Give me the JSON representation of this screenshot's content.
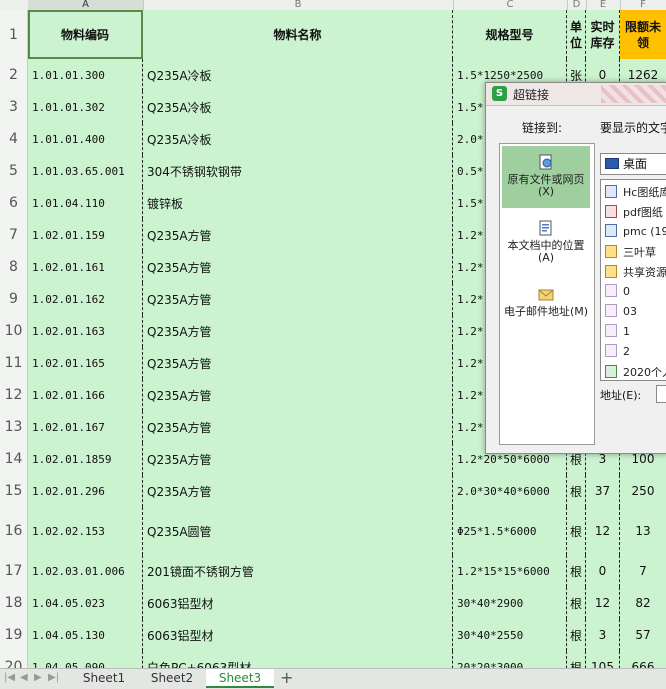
{
  "columns": [
    "A",
    "B",
    "C",
    "D",
    "E",
    "F"
  ],
  "header": {
    "row_number": "1",
    "code": "物料编码",
    "name": "物料名称",
    "spec": "规格型号",
    "unit": "单位",
    "stock": "实时库存",
    "quota": "限额未领"
  },
  "rows": [
    {
      "n": "2",
      "code": "1.01.01.300",
      "name": "Q235A冷板",
      "spec": "1.5*1250*2500",
      "unit": "张",
      "stock": "0",
      "quota": "1262"
    },
    {
      "n": "3",
      "code": "1.01.01.302",
      "name": "Q235A冷板",
      "spec": "1.5*",
      "unit": "",
      "stock": "",
      "quota": ""
    },
    {
      "n": "4",
      "code": "1.01.01.400",
      "name": "Q235A冷板",
      "spec": "2.0*",
      "unit": "",
      "stock": "",
      "quota": ""
    },
    {
      "n": "5",
      "code": "1.01.03.65.001",
      "name": "304不锈钢软钢带",
      "spec": "0.5*",
      "unit": "",
      "stock": "",
      "quota": ""
    },
    {
      "n": "6",
      "code": "1.01.04.110",
      "name": "镀锌板",
      "spec": "1.5*",
      "unit": "",
      "stock": "",
      "quota": ""
    },
    {
      "n": "7",
      "code": "1.02.01.159",
      "name": "Q235A方管",
      "spec": "1.2*",
      "unit": "",
      "stock": "",
      "quota": ""
    },
    {
      "n": "8",
      "code": "1.02.01.161",
      "name": "Q235A方管",
      "spec": "1.2*",
      "unit": "",
      "stock": "",
      "quota": ""
    },
    {
      "n": "9",
      "code": "1.02.01.162",
      "name": "Q235A方管",
      "spec": "1.2*",
      "unit": "",
      "stock": "",
      "quota": ""
    },
    {
      "n": "10",
      "code": "1.02.01.163",
      "name": "Q235A方管",
      "spec": "1.2*",
      "unit": "",
      "stock": "",
      "quota": ""
    },
    {
      "n": "11",
      "code": "1.02.01.165",
      "name": "Q235A方管",
      "spec": "1.2*",
      "unit": "",
      "stock": "",
      "quota": ""
    },
    {
      "n": "12",
      "code": "1.02.01.166",
      "name": "Q235A方管",
      "spec": "1.2*",
      "unit": "",
      "stock": "",
      "quota": ""
    },
    {
      "n": "13",
      "code": "1.02.01.167",
      "name": "Q235A方管",
      "spec": "1.2*",
      "unit": "",
      "stock": "",
      "quota": ""
    },
    {
      "n": "14",
      "code": "1.02.01.1859",
      "name": "Q235A方管",
      "spec": "1.2*20*50*6000",
      "unit": "根",
      "stock": "3",
      "quota": "100"
    },
    {
      "n": "15",
      "code": "1.02.01.296",
      "name": "Q235A方管",
      "spec": "2.0*30*40*6000",
      "unit": "根",
      "stock": "37",
      "quota": "250"
    },
    {
      "n": "16",
      "code": "1.02.02.153",
      "name": "Q235A圆管",
      "spec": "Φ25*1.5*6000",
      "unit": "根",
      "stock": "12",
      "quota": "13"
    },
    {
      "n": "17",
      "code": "1.02.03.01.006",
      "name": "201镜面不锈钢方管",
      "spec": "1.2*15*15*6000",
      "unit": "根",
      "stock": "0",
      "quota": "7"
    },
    {
      "n": "18",
      "code": "1.04.05.023",
      "name": "6063铝型材",
      "spec": "30*40*2900",
      "unit": "根",
      "stock": "12",
      "quota": "82"
    },
    {
      "n": "19",
      "code": "1.04.05.130",
      "name": "6063铝型材",
      "spec": "30*40*2550",
      "unit": "根",
      "stock": "3",
      "quota": "57"
    },
    {
      "n": "20",
      "code": "1.04.05.090",
      "name": "白色PC+6063型材",
      "spec": "20*20*3000",
      "unit": "根",
      "stock": "105",
      "quota": "666"
    }
  ],
  "sheets": [
    "Sheet1",
    "Sheet2",
    "Sheet3"
  ],
  "active_sheet": "Sheet3",
  "add_sheet": "+",
  "dialog": {
    "title": "超链接",
    "logo": "S",
    "link_to": "链接到:",
    "display_text": "要显示的文字",
    "link_types": [
      {
        "label": "原有文件或网页(X)",
        "icon": "web-file-icon"
      },
      {
        "label": "本文档中的位置(A)",
        "icon": "document-place-icon"
      },
      {
        "label": "电子邮件地址(M)",
        "icon": "email-icon"
      }
    ],
    "location": "桌面",
    "files": [
      {
        "name": "Hc图纸库",
        "icon": "doc"
      },
      {
        "name": "pdf图纸",
        "icon": "pdf"
      },
      {
        "name": "pmc (19",
        "icon": "doc"
      },
      {
        "name": "三叶草",
        "icon": "fold"
      },
      {
        "name": "共享资源",
        "icon": "fold"
      },
      {
        "name": "0",
        "icon": "img"
      },
      {
        "name": "03",
        "icon": "img"
      },
      {
        "name": "1",
        "icon": "img"
      },
      {
        "name": "2",
        "icon": "img"
      },
      {
        "name": "2020个人",
        "icon": "xls"
      }
    ],
    "address_label": "地址(E):"
  },
  "colors": {
    "cell_bg": "#ccf3cf",
    "quota_header_bg": "#ffc000",
    "active_tab": "#2f8a3d"
  }
}
